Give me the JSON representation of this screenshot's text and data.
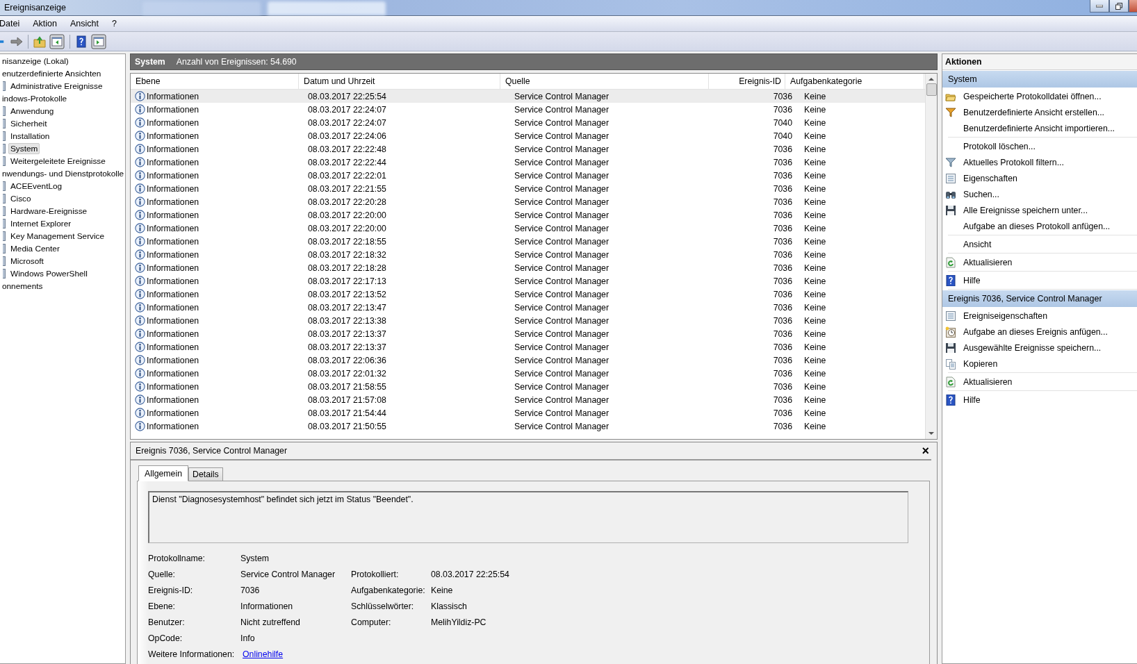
{
  "window": {
    "title": "Ereignisanzeige"
  },
  "menu": [
    "Datei",
    "Aktion",
    "Ansicht",
    "?"
  ],
  "toolbar": [
    {
      "kind": "back"
    },
    {
      "kind": "forward"
    },
    {
      "kind": "sep"
    },
    {
      "kind": "folder-up"
    },
    {
      "kind": "pane-left"
    },
    {
      "kind": "sep"
    },
    {
      "kind": "help"
    },
    {
      "kind": "pane-right"
    }
  ],
  "tree": [
    {
      "label": "nisanzeige (Lokal)",
      "selected": false,
      "children": [
        {
          "label": "enutzerdefinierte Ansichten",
          "selected": false,
          "children": [
            {
              "label": "Administrative Ereignisse",
              "selected": false
            }
          ]
        },
        {
          "label": "indows-Protokolle",
          "selected": false,
          "children": [
            {
              "label": "Anwendung",
              "selected": false
            },
            {
              "label": "Sicherheit",
              "selected": false
            },
            {
              "label": "Installation",
              "selected": false
            },
            {
              "label": "System",
              "selected": true
            },
            {
              "label": "Weitergeleitete Ereignisse",
              "selected": false
            }
          ]
        },
        {
          "label": "nwendungs- und Dienstprotokolle",
          "selected": false,
          "children": [
            {
              "label": "ACEEventLog",
              "selected": false
            },
            {
              "label": "Cisco",
              "selected": false
            },
            {
              "label": "Hardware-Ereignisse",
              "selected": false
            },
            {
              "label": "Internet Explorer",
              "selected": false
            },
            {
              "label": "Key Management Service",
              "selected": false
            },
            {
              "label": "Media Center",
              "selected": false
            },
            {
              "label": "Microsoft",
              "selected": false
            },
            {
              "label": "Windows PowerShell",
              "selected": false
            }
          ]
        },
        {
          "label": "onnements",
          "selected": false
        }
      ]
    }
  ],
  "log": {
    "name": "System",
    "count": "Anzahl von Ereignissen: 54.690"
  },
  "table": {
    "columns": [
      "Ebene",
      "Datum und Uhrzeit",
      "Quelle",
      "Ereignis-ID",
      "Aufgabenkategorie"
    ],
    "rows": [
      {
        "level": "Informationen",
        "time": "08.03.2017 22:25:54",
        "source": "Service Control Manager",
        "id": "7036",
        "category": "Keine",
        "selected": true
      },
      {
        "level": "Informationen",
        "time": "08.03.2017 22:24:07",
        "source": "Service Control Manager",
        "id": "7036",
        "category": "Keine",
        "selected": false
      },
      {
        "level": "Informationen",
        "time": "08.03.2017 22:24:07",
        "source": "Service Control Manager",
        "id": "7040",
        "category": "Keine",
        "selected": false
      },
      {
        "level": "Informationen",
        "time": "08.03.2017 22:24:06",
        "source": "Service Control Manager",
        "id": "7040",
        "category": "Keine",
        "selected": false
      },
      {
        "level": "Informationen",
        "time": "08.03.2017 22:22:48",
        "source": "Service Control Manager",
        "id": "7036",
        "category": "Keine",
        "selected": false
      },
      {
        "level": "Informationen",
        "time": "08.03.2017 22:22:44",
        "source": "Service Control Manager",
        "id": "7036",
        "category": "Keine",
        "selected": false
      },
      {
        "level": "Informationen",
        "time": "08.03.2017 22:22:01",
        "source": "Service Control Manager",
        "id": "7036",
        "category": "Keine",
        "selected": false
      },
      {
        "level": "Informationen",
        "time": "08.03.2017 22:21:55",
        "source": "Service Control Manager",
        "id": "7036",
        "category": "Keine",
        "selected": false
      },
      {
        "level": "Informationen",
        "time": "08.03.2017 22:20:28",
        "source": "Service Control Manager",
        "id": "7036",
        "category": "Keine",
        "selected": false
      },
      {
        "level": "Informationen",
        "time": "08.03.2017 22:20:00",
        "source": "Service Control Manager",
        "id": "7036",
        "category": "Keine",
        "selected": false
      },
      {
        "level": "Informationen",
        "time": "08.03.2017 22:20:00",
        "source": "Service Control Manager",
        "id": "7036",
        "category": "Keine",
        "selected": false
      },
      {
        "level": "Informationen",
        "time": "08.03.2017 22:18:55",
        "source": "Service Control Manager",
        "id": "7036",
        "category": "Keine",
        "selected": false
      },
      {
        "level": "Informationen",
        "time": "08.03.2017 22:18:32",
        "source": "Service Control Manager",
        "id": "7036",
        "category": "Keine",
        "selected": false
      },
      {
        "level": "Informationen",
        "time": "08.03.2017 22:18:28",
        "source": "Service Control Manager",
        "id": "7036",
        "category": "Keine",
        "selected": false
      },
      {
        "level": "Informationen",
        "time": "08.03.2017 22:17:13",
        "source": "Service Control Manager",
        "id": "7036",
        "category": "Keine",
        "selected": false
      },
      {
        "level": "Informationen",
        "time": "08.03.2017 22:13:52",
        "source": "Service Control Manager",
        "id": "7036",
        "category": "Keine",
        "selected": false
      },
      {
        "level": "Informationen",
        "time": "08.03.2017 22:13:47",
        "source": "Service Control Manager",
        "id": "7036",
        "category": "Keine",
        "selected": false
      },
      {
        "level": "Informationen",
        "time": "08.03.2017 22:13:38",
        "source": "Service Control Manager",
        "id": "7036",
        "category": "Keine",
        "selected": false
      },
      {
        "level": "Informationen",
        "time": "08.03.2017 22:13:37",
        "source": "Service Control Manager",
        "id": "7036",
        "category": "Keine",
        "selected": false
      },
      {
        "level": "Informationen",
        "time": "08.03.2017 22:13:37",
        "source": "Service Control Manager",
        "id": "7036",
        "category": "Keine",
        "selected": false
      },
      {
        "level": "Informationen",
        "time": "08.03.2017 22:06:36",
        "source": "Service Control Manager",
        "id": "7036",
        "category": "Keine",
        "selected": false
      },
      {
        "level": "Informationen",
        "time": "08.03.2017 22:01:32",
        "source": "Service Control Manager",
        "id": "7036",
        "category": "Keine",
        "selected": false
      },
      {
        "level": "Informationen",
        "time": "08.03.2017 21:58:55",
        "source": "Service Control Manager",
        "id": "7036",
        "category": "Keine",
        "selected": false
      },
      {
        "level": "Informationen",
        "time": "08.03.2017 21:57:08",
        "source": "Service Control Manager",
        "id": "7036",
        "category": "Keine",
        "selected": false
      },
      {
        "level": "Informationen",
        "time": "08.03.2017 21:54:44",
        "source": "Service Control Manager",
        "id": "7036",
        "category": "Keine",
        "selected": false
      },
      {
        "level": "Informationen",
        "time": "08.03.2017 21:50:55",
        "source": "Service Control Manager",
        "id": "7036",
        "category": "Keine",
        "selected": false
      }
    ]
  },
  "details": {
    "title": "Ereignis 7036, Service Control Manager",
    "close": "×",
    "tabs": [
      {
        "label": "Allgemein",
        "selected": true
      },
      {
        "label": "Details",
        "selected": false
      }
    ],
    "message": "Dienst \"Diagnosesystemhost\" befindet sich jetzt im Status \"Beendet\".",
    "fields": [
      [
        {
          "label": "Protokollname:",
          "value": "System"
        }
      ],
      [
        {
          "label": "Quelle:",
          "value": "Service Control Manager"
        },
        {
          "label": "Protokolliert:",
          "value": "08.03.2017 22:25:54"
        }
      ],
      [
        {
          "label": "Ereignis-ID:",
          "value": "7036"
        },
        {
          "label": "Aufgabenkategorie:",
          "value": "Keine"
        }
      ],
      [
        {
          "label": "Ebene:",
          "value": "Informationen"
        },
        {
          "label": "Schlüsselwörter:",
          "value": "Klassisch"
        }
      ],
      [
        {
          "label": "Benutzer:",
          "value": "Nicht zutreffend"
        },
        {
          "label": "Computer:",
          "value": "MelihYildiz-PC"
        }
      ],
      [
        {
          "label": "OpCode:",
          "value": "Info"
        }
      ],
      [
        {
          "label": "Weitere Informationen:",
          "value": "Onlinehilfe",
          "kind": "link"
        }
      ]
    ]
  },
  "actions": {
    "title": "Aktionen",
    "sections": [
      {
        "title": "System",
        "groups": [
          [
            {
              "label": "Gespeicherte Protokolldatei öffnen...",
              "kind": "folder"
            },
            {
              "label": "Benutzerdefinierte Ansicht erstellen...",
              "kind": "funnel-star"
            },
            {
              "label": "Benutzerdefinierte Ansicht importieren...",
              "kind": "plain"
            }
          ],
          [
            {
              "label": "Protokoll löschen...",
              "kind": "plain"
            },
            {
              "label": "Aktuelles Protokoll filtern...",
              "kind": "funnel"
            },
            {
              "label": "Eigenschaften",
              "kind": "sheet"
            },
            {
              "label": "Suchen...",
              "kind": "binoculars"
            },
            {
              "label": "Alle Ereignisse speichern unter...",
              "kind": "floppy"
            },
            {
              "label": "Aufgabe an dieses Protokoll anfügen...",
              "kind": "plain"
            }
          ],
          [
            {
              "label": "Ansicht",
              "kind": "plain"
            }
          ],
          [
            {
              "label": "Aktualisieren",
              "kind": "refresh"
            }
          ],
          [
            {
              "label": "Hilfe",
              "kind": "help"
            }
          ]
        ]
      },
      {
        "title": "Ereignis 7036, Service Control Manager",
        "groups": [
          [
            {
              "label": "Ereigniseigenschaften",
              "kind": "sheet"
            },
            {
              "label": "Aufgabe an dieses Ereignis anfügen...",
              "kind": "clock"
            },
            {
              "label": "Ausgewählte Ereignisse speichern...",
              "kind": "floppy"
            },
            {
              "label": "Kopieren",
              "kind": "copy"
            }
          ],
          [
            {
              "label": "Aktualisieren",
              "kind": "refresh"
            }
          ],
          [
            {
              "label": "Hilfe",
              "kind": "help"
            }
          ]
        ]
      }
    ]
  }
}
